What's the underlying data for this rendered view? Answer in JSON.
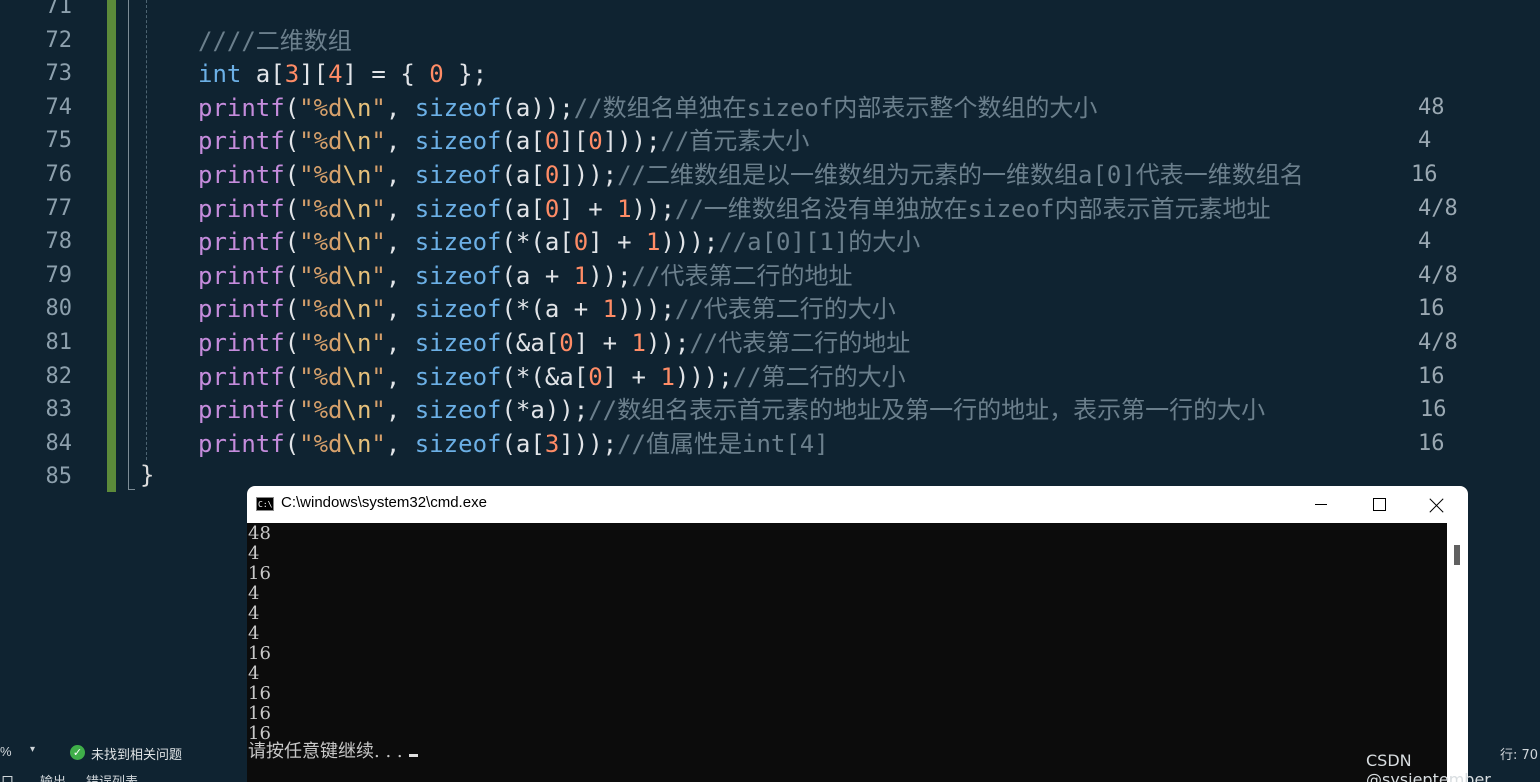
{
  "editor": {
    "line_numbers": [
      "71",
      "72",
      "73",
      "74",
      "75",
      "76",
      "77",
      "78",
      "79",
      "80",
      "81",
      "82",
      "83",
      "84",
      "85"
    ],
    "lines": [
      {
        "tokens": []
      },
      {
        "tokens": [
          {
            "t": "cmt",
            "v": "////二维数组"
          }
        ]
      },
      {
        "tokens": [
          {
            "t": "kw",
            "v": "int"
          },
          {
            "t": "txt",
            "v": " a["
          },
          {
            "t": "num",
            "v": "3"
          },
          {
            "t": "txt",
            "v": "]["
          },
          {
            "t": "num",
            "v": "4"
          },
          {
            "t": "txt",
            "v": "] = { "
          },
          {
            "t": "num",
            "v": "0"
          },
          {
            "t": "txt",
            "v": " };"
          }
        ]
      },
      {
        "tokens": [
          {
            "t": "fn",
            "v": "printf"
          },
          {
            "t": "txt",
            "v": "("
          },
          {
            "t": "str",
            "v": "\"%d"
          },
          {
            "t": "esc",
            "v": "\\n"
          },
          {
            "t": "str",
            "v": "\""
          },
          {
            "t": "txt",
            "v": ", "
          },
          {
            "t": "kw",
            "v": "sizeof"
          },
          {
            "t": "txt",
            "v": "(a));"
          },
          {
            "t": "cmt",
            "v": "//数组名单独在sizeof内部表示整个数组的大小"
          }
        ]
      },
      {
        "tokens": [
          {
            "t": "fn",
            "v": "printf"
          },
          {
            "t": "txt",
            "v": "("
          },
          {
            "t": "str",
            "v": "\"%d"
          },
          {
            "t": "esc",
            "v": "\\n"
          },
          {
            "t": "str",
            "v": "\""
          },
          {
            "t": "txt",
            "v": ", "
          },
          {
            "t": "kw",
            "v": "sizeof"
          },
          {
            "t": "txt",
            "v": "(a["
          },
          {
            "t": "num",
            "v": "0"
          },
          {
            "t": "txt",
            "v": "]["
          },
          {
            "t": "num",
            "v": "0"
          },
          {
            "t": "txt",
            "v": "]));"
          },
          {
            "t": "cmt",
            "v": "//首元素大小"
          }
        ]
      },
      {
        "tokens": [
          {
            "t": "fn",
            "v": "printf"
          },
          {
            "t": "txt",
            "v": "("
          },
          {
            "t": "str",
            "v": "\"%d"
          },
          {
            "t": "esc",
            "v": "\\n"
          },
          {
            "t": "str",
            "v": "\""
          },
          {
            "t": "txt",
            "v": ", "
          },
          {
            "t": "kw",
            "v": "sizeof"
          },
          {
            "t": "txt",
            "v": "(a["
          },
          {
            "t": "num",
            "v": "0"
          },
          {
            "t": "txt",
            "v": "]));"
          },
          {
            "t": "cmt",
            "v": "//二维数组是以一维数组为元素的一维数组a[0]代表一维数组名"
          }
        ]
      },
      {
        "tokens": [
          {
            "t": "fn",
            "v": "printf"
          },
          {
            "t": "txt",
            "v": "("
          },
          {
            "t": "str",
            "v": "\"%d"
          },
          {
            "t": "esc",
            "v": "\\n"
          },
          {
            "t": "str",
            "v": "\""
          },
          {
            "t": "txt",
            "v": ", "
          },
          {
            "t": "kw",
            "v": "sizeof"
          },
          {
            "t": "txt",
            "v": "(a["
          },
          {
            "t": "num",
            "v": "0"
          },
          {
            "t": "txt",
            "v": "] + "
          },
          {
            "t": "num",
            "v": "1"
          },
          {
            "t": "txt",
            "v": "));"
          },
          {
            "t": "cmt",
            "v": "//一维数组名没有单独放在sizeof内部表示首元素地址"
          }
        ]
      },
      {
        "tokens": [
          {
            "t": "fn",
            "v": "printf"
          },
          {
            "t": "txt",
            "v": "("
          },
          {
            "t": "str",
            "v": "\"%d"
          },
          {
            "t": "esc",
            "v": "\\n"
          },
          {
            "t": "str",
            "v": "\""
          },
          {
            "t": "txt",
            "v": ", "
          },
          {
            "t": "kw",
            "v": "sizeof"
          },
          {
            "t": "txt",
            "v": "(*(a["
          },
          {
            "t": "num",
            "v": "0"
          },
          {
            "t": "txt",
            "v": "] + "
          },
          {
            "t": "num",
            "v": "1"
          },
          {
            "t": "txt",
            "v": ")));"
          },
          {
            "t": "cmt",
            "v": "//a[0][1]的大小"
          }
        ]
      },
      {
        "tokens": [
          {
            "t": "fn",
            "v": "printf"
          },
          {
            "t": "txt",
            "v": "("
          },
          {
            "t": "str",
            "v": "\"%d"
          },
          {
            "t": "esc",
            "v": "\\n"
          },
          {
            "t": "str",
            "v": "\""
          },
          {
            "t": "txt",
            "v": ", "
          },
          {
            "t": "kw",
            "v": "sizeof"
          },
          {
            "t": "txt",
            "v": "(a + "
          },
          {
            "t": "num",
            "v": "1"
          },
          {
            "t": "txt",
            "v": "));"
          },
          {
            "t": "cmt",
            "v": "//代表第二行的地址"
          }
        ]
      },
      {
        "tokens": [
          {
            "t": "fn",
            "v": "printf"
          },
          {
            "t": "txt",
            "v": "("
          },
          {
            "t": "str",
            "v": "\"%d"
          },
          {
            "t": "esc",
            "v": "\\n"
          },
          {
            "t": "str",
            "v": "\""
          },
          {
            "t": "txt",
            "v": ", "
          },
          {
            "t": "kw",
            "v": "sizeof"
          },
          {
            "t": "txt",
            "v": "(*(a + "
          },
          {
            "t": "num",
            "v": "1"
          },
          {
            "t": "txt",
            "v": ")));"
          },
          {
            "t": "cmt",
            "v": "//代表第二行的大小"
          }
        ]
      },
      {
        "tokens": [
          {
            "t": "fn",
            "v": "printf"
          },
          {
            "t": "txt",
            "v": "("
          },
          {
            "t": "str",
            "v": "\"%d"
          },
          {
            "t": "esc",
            "v": "\\n"
          },
          {
            "t": "str",
            "v": "\""
          },
          {
            "t": "txt",
            "v": ", "
          },
          {
            "t": "kw",
            "v": "sizeof"
          },
          {
            "t": "txt",
            "v": "(&a["
          },
          {
            "t": "num",
            "v": "0"
          },
          {
            "t": "txt",
            "v": "] + "
          },
          {
            "t": "num",
            "v": "1"
          },
          {
            "t": "txt",
            "v": "));"
          },
          {
            "t": "cmt",
            "v": "//代表第二行的地址"
          }
        ]
      },
      {
        "tokens": [
          {
            "t": "fn",
            "v": "printf"
          },
          {
            "t": "txt",
            "v": "("
          },
          {
            "t": "str",
            "v": "\"%d"
          },
          {
            "t": "esc",
            "v": "\\n"
          },
          {
            "t": "str",
            "v": "\""
          },
          {
            "t": "txt",
            "v": ", "
          },
          {
            "t": "kw",
            "v": "sizeof"
          },
          {
            "t": "txt",
            "v": "(*(&a["
          },
          {
            "t": "num",
            "v": "0"
          },
          {
            "t": "txt",
            "v": "] + "
          },
          {
            "t": "num",
            "v": "1"
          },
          {
            "t": "txt",
            "v": ")));"
          },
          {
            "t": "cmt",
            "v": "//第二行的大小"
          }
        ]
      },
      {
        "tokens": [
          {
            "t": "fn",
            "v": "printf"
          },
          {
            "t": "txt",
            "v": "("
          },
          {
            "t": "str",
            "v": "\"%d"
          },
          {
            "t": "esc",
            "v": "\\n"
          },
          {
            "t": "str",
            "v": "\""
          },
          {
            "t": "txt",
            "v": ", "
          },
          {
            "t": "kw",
            "v": "sizeof"
          },
          {
            "t": "txt",
            "v": "(*a));"
          },
          {
            "t": "cmt",
            "v": "//数组名表示首元素的地址及第一行的地址，表示第一行的大小"
          }
        ]
      },
      {
        "tokens": [
          {
            "t": "fn",
            "v": "printf"
          },
          {
            "t": "txt",
            "v": "("
          },
          {
            "t": "str",
            "v": "\"%d"
          },
          {
            "t": "esc",
            "v": "\\n"
          },
          {
            "t": "str",
            "v": "\""
          },
          {
            "t": "txt",
            "v": ", "
          },
          {
            "t": "kw",
            "v": "sizeof"
          },
          {
            "t": "txt",
            "v": "(a["
          },
          {
            "t": "num",
            "v": "3"
          },
          {
            "t": "txt",
            "v": "]));"
          },
          {
            "t": "cmt",
            "v": "//值属性是int[4]"
          }
        ]
      }
    ],
    "closing_brace": "}",
    "results": [
      "48",
      "4",
      "16",
      "4/8",
      "4",
      "4/8",
      "16",
      "4/8",
      "16",
      "16",
      "16"
    ]
  },
  "status": {
    "zoom_suffix": "%",
    "dropdown_glyph": "▾",
    "check_glyph": "✓",
    "issues_text": "未找到相关问题",
    "line_indicator": "行: 70",
    "bottom_tabs": [
      "窗口",
      "输出",
      "错误列表"
    ]
  },
  "watermark": "CSDN @sysjeptember",
  "cmd": {
    "title": "C:\\windows\\system32\\cmd.exe",
    "icon_text": "C:\\",
    "output": [
      "48",
      "4",
      "16",
      "4",
      "4",
      "4",
      "16",
      "4",
      "16",
      "16",
      "16"
    ],
    "prompt": "请按任意键继续. . ."
  }
}
